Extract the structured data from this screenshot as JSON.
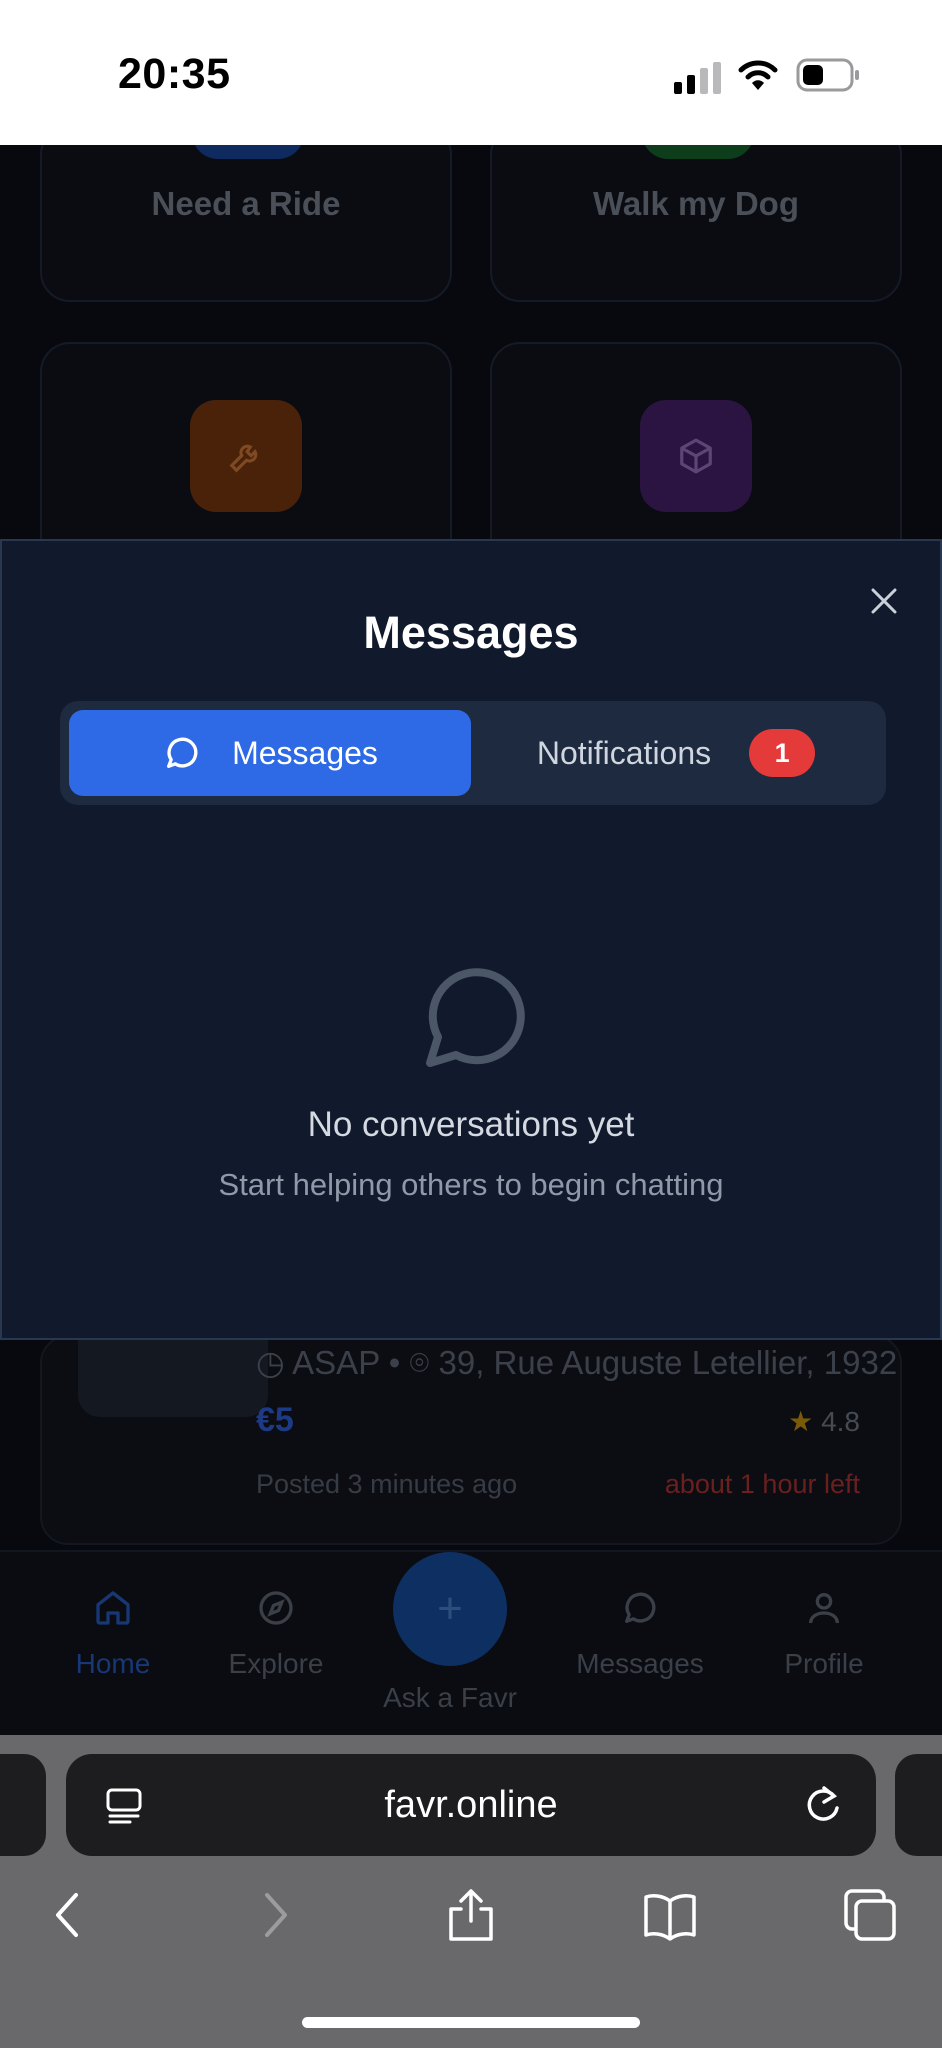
{
  "status_bar": {
    "time": "20:35",
    "icons": [
      "cellular-signal-icon",
      "wifi-icon",
      "battery-icon"
    ]
  },
  "background": {
    "categories": [
      {
        "label": "Need a Ride",
        "icon": "car-icon",
        "color": "#1e4fb8"
      },
      {
        "label": "Walk my Dog",
        "icon": "dog-icon",
        "color": "#1f8f3a"
      },
      {
        "label": "",
        "icon": "wrench-icon",
        "color": "#6b2e0c"
      },
      {
        "label": "",
        "icon": "package-icon",
        "color": "#3f1d5c"
      }
    ],
    "task": {
      "time": "ASAP",
      "location": "39, Rue Auguste Letellier, 1932",
      "price": "€5",
      "rating": "4.8",
      "posted": "Posted 3 minutes ago",
      "time_left": "about 1 hour left"
    },
    "nav": {
      "home": "Home",
      "explore": "Explore",
      "ask": "Ask a Favr",
      "messages": "Messages",
      "profile": "Profile"
    }
  },
  "modal": {
    "title": "Messages",
    "tabs": {
      "messages": "Messages",
      "notifications": "Notifications",
      "notifications_badge": "1"
    },
    "empty": {
      "title": "No conversations yet",
      "subtitle": "Start helping others to begin chatting"
    }
  },
  "safari": {
    "url": "favr.online"
  },
  "colors": {
    "accent": "#2f6ae6",
    "modal_bg": "#111a2d",
    "badge": "#e53a3a"
  }
}
